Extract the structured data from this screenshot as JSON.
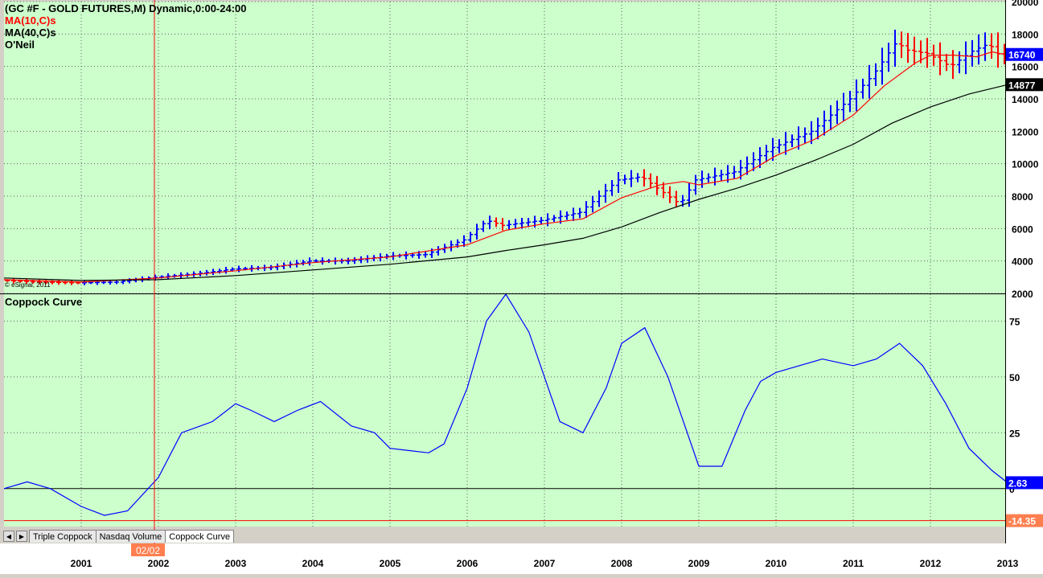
{
  "window": {
    "header": "(GC #F - GOLD FUTURES,M) Dynamic,0:00-24:00",
    "studies": [
      {
        "label": "MA(10,C)s",
        "color": "#ff0000"
      },
      {
        "label": "MA(40,C)s",
        "color": "#000000"
      },
      {
        "label": "O'Neil",
        "color": "#000000"
      }
    ],
    "copyright": "© eSignal, 2011",
    "cursor_date": "02/02"
  },
  "tabs": [
    "Triple Coppock",
    "Nasdaq Volume",
    "Coppock Curve"
  ],
  "active_tab": "Coppock Curve",
  "colors": {
    "plot_bg": "#ccffcc",
    "up_bar": "#0000ff",
    "down_bar": "#ff0000",
    "ma10": "#ff0000",
    "ma40": "#000000",
    "coppock": "#0000ff",
    "cursor": "#ff0000"
  },
  "chart_data": [
    {
      "type": "line",
      "title": "(GC #F - GOLD FUTURES,M) Dynamic,0:00-24:00",
      "ylim": [
        2000,
        20000
      ],
      "yticks": [
        "20000",
        "18000",
        "16000",
        "14000",
        "12000",
        "10000",
        "8000",
        "6000",
        "4000",
        "2000"
      ],
      "ytick_values": [
        20000,
        18000,
        16000,
        14000,
        12000,
        10000,
        8000,
        6000,
        4000,
        2000
      ],
      "xticks": [
        "2001",
        "2002",
        "2003",
        "2004",
        "2005",
        "2006",
        "2007",
        "2008",
        "2009",
        "2010",
        "2011",
        "2012",
        "2013"
      ],
      "price_points": [
        [
          2000.0,
          2800
        ],
        [
          2000.5,
          2700
        ],
        [
          2001.0,
          2650
        ],
        [
          2001.5,
          2700
        ],
        [
          2002.0,
          3000
        ],
        [
          2002.5,
          3200
        ],
        [
          2003.0,
          3500
        ],
        [
          2003.5,
          3600
        ],
        [
          2004.0,
          4000
        ],
        [
          2004.5,
          4000
        ],
        [
          2005.0,
          4300
        ],
        [
          2005.5,
          4400
        ],
        [
          2006.0,
          5300
        ],
        [
          2006.3,
          6500
        ],
        [
          2006.5,
          6200
        ],
        [
          2007.0,
          6500
        ],
        [
          2007.5,
          7000
        ],
        [
          2008.0,
          9000
        ],
        [
          2008.3,
          9200
        ],
        [
          2008.5,
          8500
        ],
        [
          2008.8,
          7500
        ],
        [
          2009.0,
          9000
        ],
        [
          2009.5,
          9500
        ],
        [
          2010.0,
          11000
        ],
        [
          2010.5,
          12000
        ],
        [
          2011.0,
          14000
        ],
        [
          2011.3,
          15500
        ],
        [
          2011.6,
          17500
        ],
        [
          2011.75,
          17000
        ],
        [
          2012.0,
          16800
        ],
        [
          2012.3,
          16000
        ],
        [
          2012.6,
          17000
        ],
        [
          2012.8,
          17400
        ],
        [
          2012.95,
          16600
        ],
        [
          2013.0,
          16740
        ]
      ],
      "series": [
        {
          "name": "MA(10,C)s",
          "color": "#ff0000",
          "points": [
            [
              2000.0,
              2850
            ],
            [
              2001.0,
              2700
            ],
            [
              2002.0,
              2950
            ],
            [
              2003.0,
              3400
            ],
            [
              2004.0,
              3900
            ],
            [
              2005.0,
              4250
            ],
            [
              2006.0,
              5000
            ],
            [
              2006.5,
              5900
            ],
            [
              2007.0,
              6300
            ],
            [
              2007.5,
              6600
            ],
            [
              2008.0,
              7900
            ],
            [
              2008.5,
              8700
            ],
            [
              2008.8,
              8900
            ],
            [
              2009.0,
              8700
            ],
            [
              2009.5,
              9100
            ],
            [
              2010.0,
              10500
            ],
            [
              2010.5,
              11500
            ],
            [
              2011.0,
              13000
            ],
            [
              2011.4,
              14800
            ],
            [
              2011.8,
              16200
            ],
            [
              2012.0,
              16700
            ],
            [
              2012.3,
              16700
            ],
            [
              2012.6,
              16600
            ],
            [
              2012.8,
              16900
            ],
            [
              2013.0,
              16700
            ]
          ]
        },
        {
          "name": "MA(40,C)s",
          "color": "#000000",
          "points": [
            [
              2000.0,
              2950
            ],
            [
              2001.0,
              2800
            ],
            [
              2002.0,
              2850
            ],
            [
              2003.0,
              3100
            ],
            [
              2004.0,
              3450
            ],
            [
              2005.0,
              3800
            ],
            [
              2006.0,
              4250
            ],
            [
              2006.5,
              4650
            ],
            [
              2007.0,
              5000
            ],
            [
              2007.5,
              5400
            ],
            [
              2008.0,
              6100
            ],
            [
              2008.5,
              7000
            ],
            [
              2009.0,
              7800
            ],
            [
              2009.5,
              8500
            ],
            [
              2010.0,
              9300
            ],
            [
              2010.5,
              10200
            ],
            [
              2011.0,
              11200
            ],
            [
              2011.5,
              12500
            ],
            [
              2012.0,
              13500
            ],
            [
              2012.5,
              14300
            ],
            [
              2013.0,
              14877
            ]
          ]
        }
      ],
      "last_price_label": "16740",
      "ma40_label": "14877"
    },
    {
      "type": "line",
      "title": "Coppock Curve",
      "ylim": [
        -17,
        87
      ],
      "yticks": [
        "75",
        "50",
        "25",
        "0"
      ],
      "ytick_values": [
        75,
        50,
        25,
        0
      ],
      "series": [
        {
          "name": "Coppock Curve",
          "color": "#0000ff",
          "points": [
            [
              2000.0,
              0
            ],
            [
              2000.3,
              3
            ],
            [
              2000.6,
              0
            ],
            [
              2001.0,
              -8
            ],
            [
              2001.3,
              -12
            ],
            [
              2001.6,
              -10
            ],
            [
              2002.0,
              5
            ],
            [
              2002.3,
              25
            ],
            [
              2002.7,
              30
            ],
            [
              2003.0,
              38
            ],
            [
              2003.2,
              35
            ],
            [
              2003.5,
              30
            ],
            [
              2003.8,
              35
            ],
            [
              2004.1,
              39
            ],
            [
              2004.5,
              28
            ],
            [
              2004.8,
              25
            ],
            [
              2005.0,
              18
            ],
            [
              2005.5,
              16
            ],
            [
              2005.7,
              20
            ],
            [
              2006.0,
              45
            ],
            [
              2006.25,
              75
            ],
            [
              2006.5,
              87
            ],
            [
              2006.8,
              70
            ],
            [
              2007.2,
              30
            ],
            [
              2007.5,
              25
            ],
            [
              2007.8,
              45
            ],
            [
              2008.0,
              65
            ],
            [
              2008.3,
              72
            ],
            [
              2008.6,
              50
            ],
            [
              2009.0,
              10
            ],
            [
              2009.3,
              10
            ],
            [
              2009.6,
              35
            ],
            [
              2009.8,
              48
            ],
            [
              2010.0,
              52
            ],
            [
              2010.3,
              55
            ],
            [
              2010.6,
              58
            ],
            [
              2011.0,
              55
            ],
            [
              2011.3,
              58
            ],
            [
              2011.6,
              65
            ],
            [
              2011.9,
              55
            ],
            [
              2012.2,
              38
            ],
            [
              2012.5,
              18
            ],
            [
              2012.8,
              8
            ],
            [
              2013.0,
              2.63
            ]
          ]
        }
      ],
      "last_value_label": "2.63",
      "lower_label": "-14.35"
    }
  ]
}
